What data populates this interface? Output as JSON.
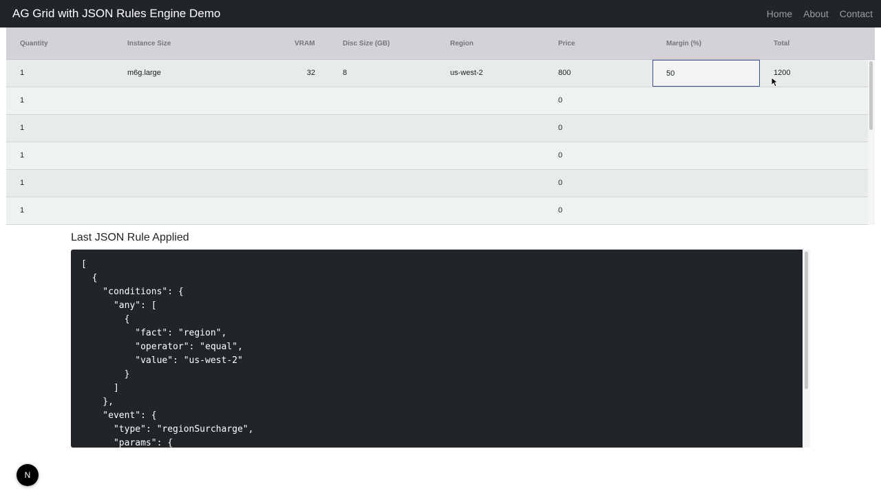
{
  "navbar": {
    "brand": "AG Grid with JSON Rules Engine Demo",
    "links": [
      "Home",
      "About",
      "Contact"
    ]
  },
  "grid": {
    "columns": [
      "Quantity",
      "Instance Size",
      "VRAM",
      "Disc Size (GB)",
      "Region",
      "Price",
      "Margin (%)",
      "Total"
    ],
    "rows": [
      {
        "quantity": "1",
        "instance_size": "m6g.large",
        "vram": "32",
        "disc_size": "8",
        "region": "us-west-2",
        "price": "800",
        "margin": "50",
        "total": "1200"
      },
      {
        "quantity": "1",
        "instance_size": "",
        "vram": "",
        "disc_size": "",
        "region": "",
        "price": "0",
        "margin": "",
        "total": ""
      },
      {
        "quantity": "1",
        "instance_size": "",
        "vram": "",
        "disc_size": "",
        "region": "",
        "price": "0",
        "margin": "",
        "total": ""
      },
      {
        "quantity": "1",
        "instance_size": "",
        "vram": "",
        "disc_size": "",
        "region": "",
        "price": "0",
        "margin": "",
        "total": ""
      },
      {
        "quantity": "1",
        "instance_size": "",
        "vram": "",
        "disc_size": "",
        "region": "",
        "price": "0",
        "margin": "",
        "total": ""
      },
      {
        "quantity": "1",
        "instance_size": "",
        "vram": "",
        "disc_size": "",
        "region": "",
        "price": "0",
        "margin": "",
        "total": ""
      }
    ]
  },
  "rule_panel": {
    "title": "Last JSON Rule Applied",
    "code_lines": [
      "[",
      "  {",
      "    \"conditions\": {",
      "      \"any\": [",
      "        {",
      "          \"fact\": \"region\",",
      "          \"operator\": \"equal\",",
      "          \"value\": \"us-west-2\"",
      "        }",
      "      ]",
      "    },",
      "    \"event\": {",
      "      \"type\": \"regionSurcharge\",",
      "      \"params\": {"
    ]
  },
  "badge": {
    "label": "N"
  }
}
